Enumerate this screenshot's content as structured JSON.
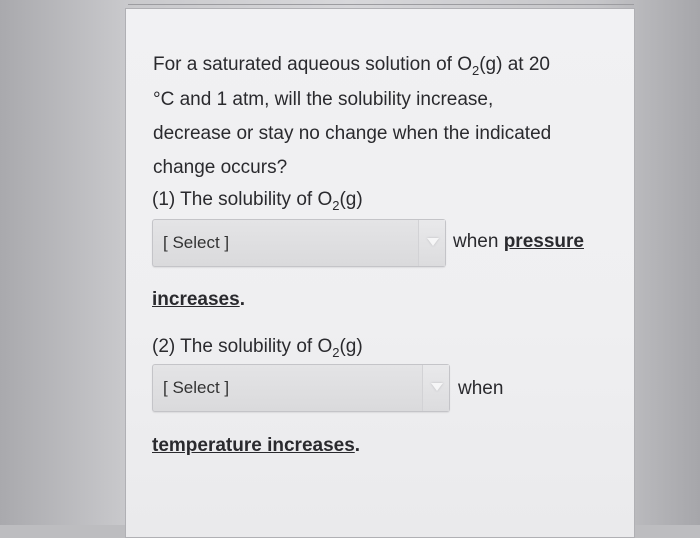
{
  "question": {
    "text_before_formula": "For a saturated aqueous solution of O",
    "subscript": "2",
    "text_after_formula": "(g) at 20",
    "line2": "°C and 1 atm, will the solubility increase,",
    "line3": "decrease or stay no change when the indicated",
    "line4": "change occurs?"
  },
  "part1": {
    "label_before": "(1) The solubility of O",
    "subscript": "2",
    "label_after": "(g)",
    "select_value": "[ Select ]",
    "after_select_text": "when",
    "after_select_emph": "pressure",
    "continuation_emph": "increases",
    "continuation_end": "."
  },
  "part2": {
    "label_before": "(2) The solubility of O",
    "subscript": "2",
    "label_after": "(g)",
    "select_value": "[ Select ]",
    "after_select_text": "when",
    "continuation_emph": "temperature increases",
    "continuation_end": "."
  },
  "icons": {
    "dropdown": "chevron-down-icon"
  }
}
